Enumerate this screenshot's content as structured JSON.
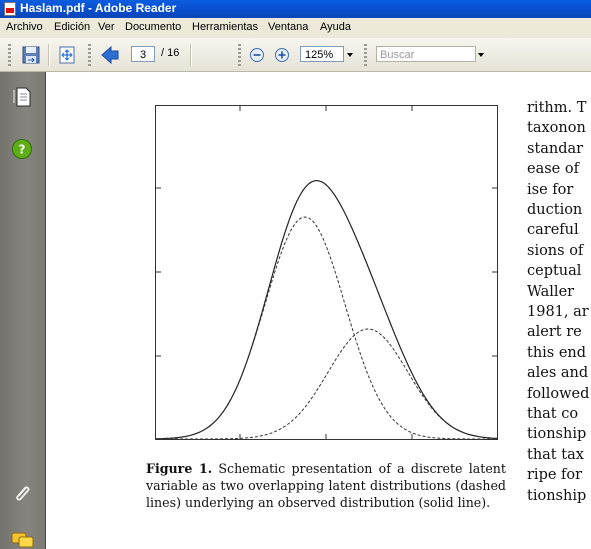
{
  "window": {
    "title": "Haslam.pdf - Adobe Reader"
  },
  "menu": {
    "items": [
      "Archivo",
      "Edición",
      "Ver",
      "Documento",
      "Herramientas",
      "Ventana",
      "Ayuda"
    ]
  },
  "toolbar": {
    "current_page": "3",
    "page_separator": "/ 16",
    "zoom_value": "125%",
    "search_placeholder": "Buscar"
  },
  "document": {
    "figure": {
      "caption_label": "Figure 1.",
      "caption_text": "Schematic presentation of a discrete latent variable as two overlapping latent distributions (dashed lines) underlying an observed distribution (solid line)."
    },
    "right_column_lines": [
      "rithm. T",
      "taxonon",
      "standar",
      "ease of",
      "ise for",
      "duction",
      "careful",
      "sions of",
      "ceptual",
      "Waller",
      "1981, ar",
      "alert re",
      "this end",
      "ales and",
      "followed",
      "that  co",
      "tionship",
      "that tax",
      "ripe for",
      "tionship"
    ]
  },
  "colors": {
    "titlebar": "#0a4fd0",
    "menubar": "#ece9d8",
    "navpane": "#7d7c76",
    "nav_help": "#5fae18",
    "back_arrow": "#2f6fd3"
  },
  "icons": {
    "nav": [
      "pages-icon",
      "help-icon",
      "attachment-icon",
      "comments-icon"
    ],
    "toolbar": [
      "save-icon",
      "fit-page-icon",
      "back-arrow-icon",
      "zoom-out-icon",
      "zoom-in-icon"
    ]
  }
}
